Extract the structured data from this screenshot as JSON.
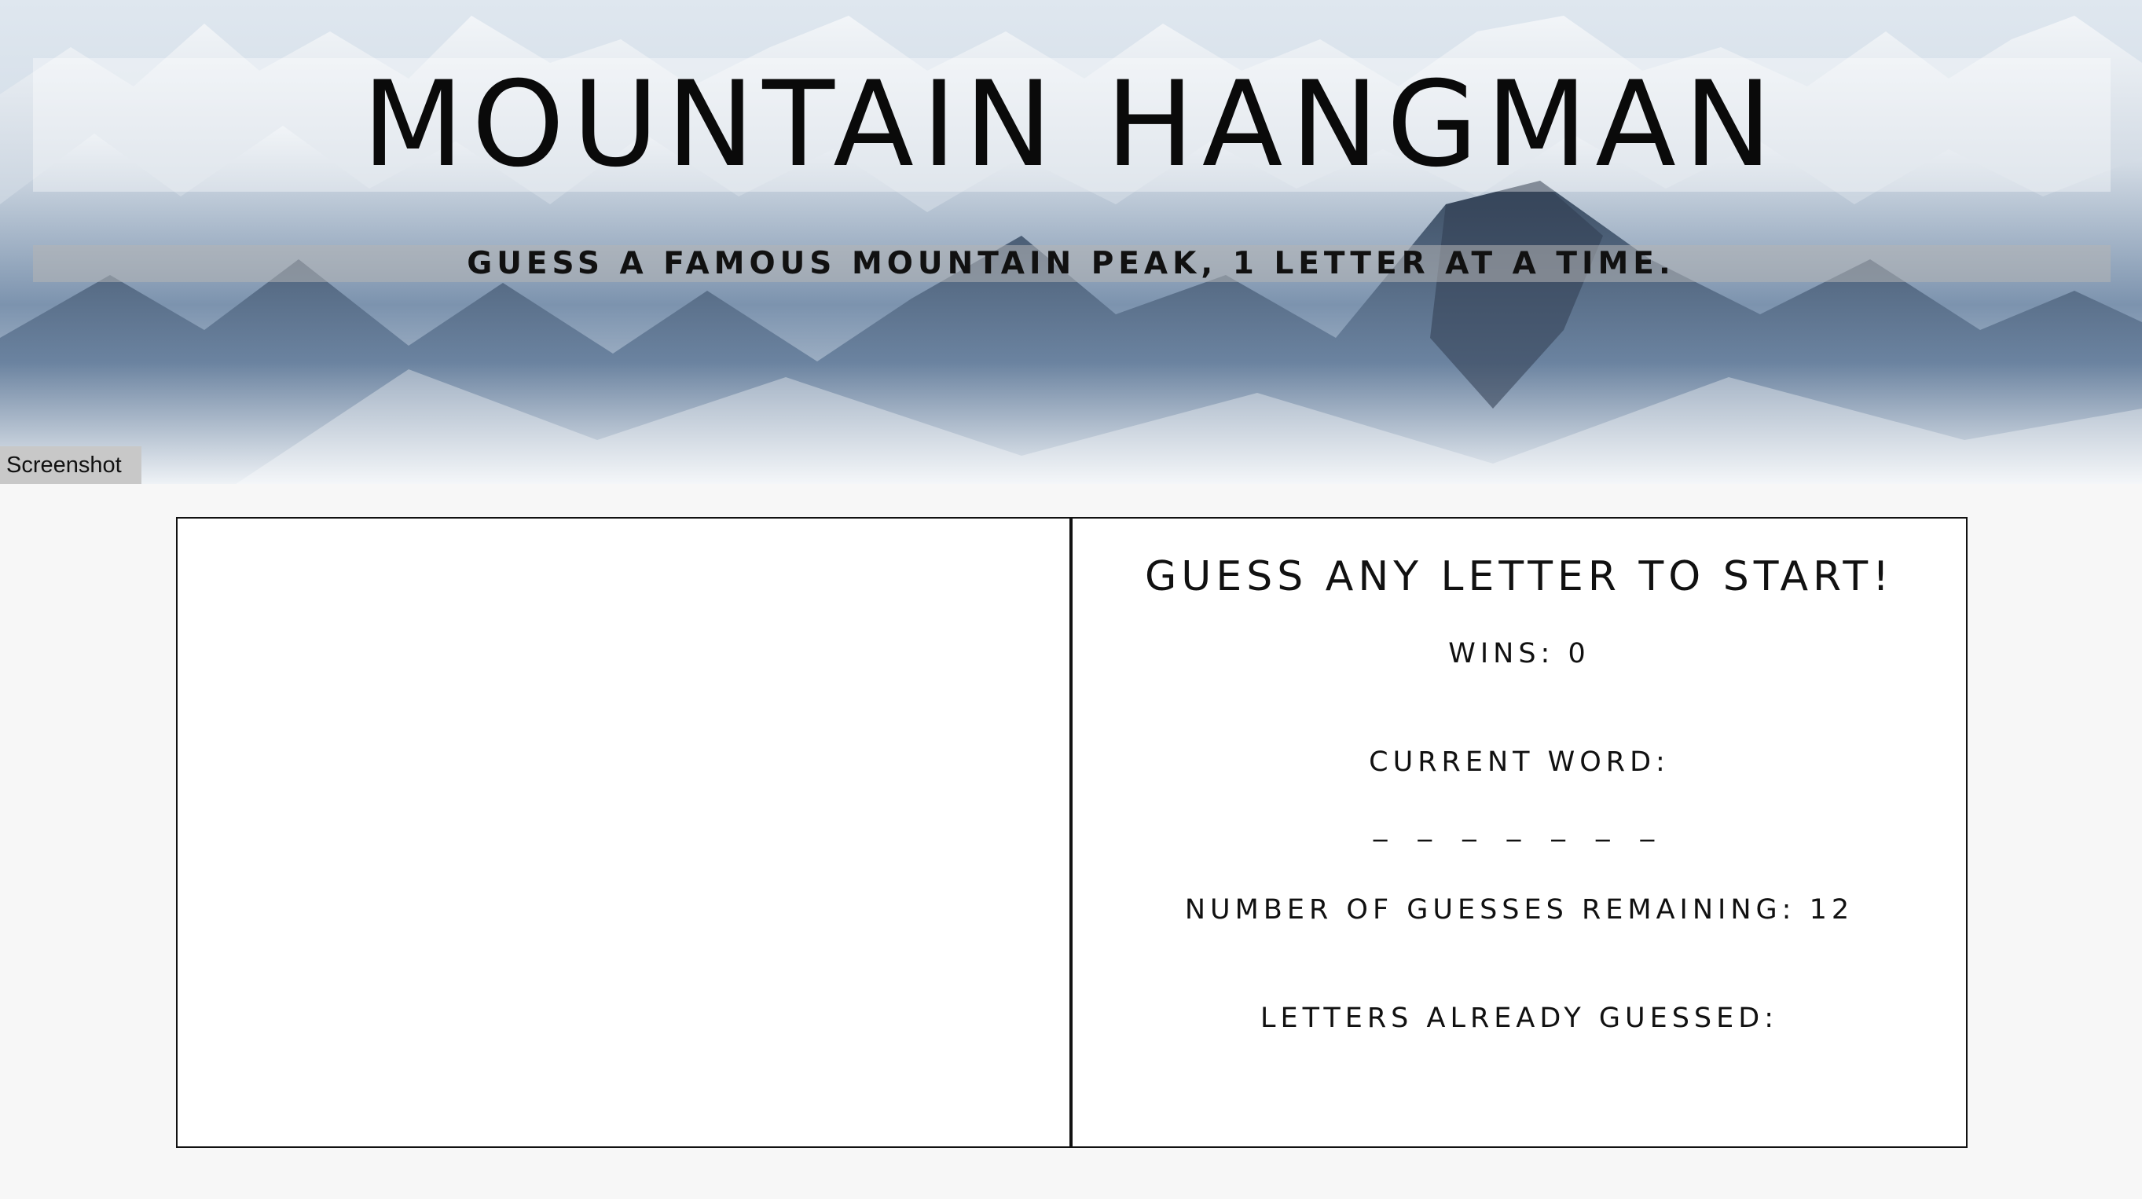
{
  "header": {
    "title": "MOUNTAIN HANGMAN",
    "subtitle": "GUESS A FAMOUS MOUNTAIN PEAK, 1 LETTER AT A TIME."
  },
  "screenshot_button": {
    "label": "Screenshot"
  },
  "game": {
    "prompt": "GUESS ANY LETTER TO START!",
    "wins": "WINS: 0",
    "current_word_label": "CURRENT WORD:",
    "current_word": "_ _ _ _ _ _ _",
    "guesses_remaining": "NUMBER OF GUESSES REMAINING: 12",
    "letters_guessed_label": "LETTERS ALREADY GUESSED:",
    "letters_guessed": ""
  }
}
